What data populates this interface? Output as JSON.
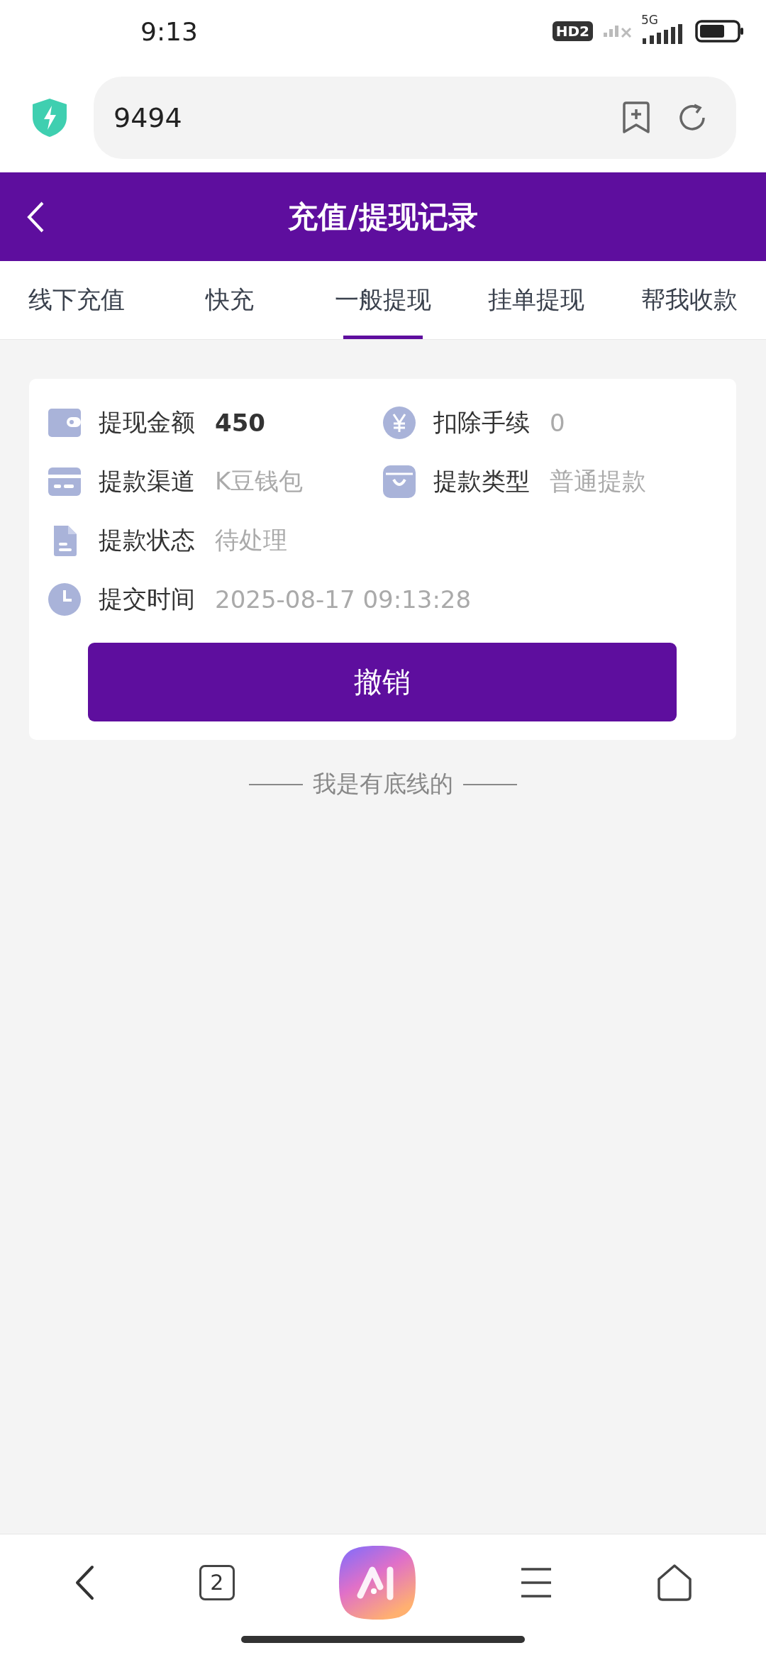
{
  "status_bar": {
    "time": "9:13",
    "hd_badge": "HD2",
    "network": "5G"
  },
  "address_bar": {
    "url": "9494"
  },
  "header": {
    "title": "充值/提现记录"
  },
  "tabs": [
    {
      "label": "线下充值",
      "selected": false
    },
    {
      "label": "快充",
      "selected": false
    },
    {
      "label": "一般提现",
      "selected": true
    },
    {
      "label": "挂单提现",
      "selected": false
    },
    {
      "label": "帮我收款",
      "selected": false
    }
  ],
  "record": {
    "rows": [
      [
        {
          "kind": "wallet",
          "label": "提现金额",
          "value": "450",
          "bold": true
        },
        {
          "kind": "yen",
          "label": "扣除手续",
          "value": "0",
          "bold": false
        }
      ],
      [
        {
          "kind": "card",
          "label": "提款渠道",
          "value": "K豆钱包",
          "bold": false
        },
        {
          "kind": "bag",
          "label": "提款类型",
          "value": "普通提款",
          "bold": false
        }
      ],
      [
        {
          "kind": "document",
          "label": "提款状态",
          "value": "待处理",
          "bold": false
        }
      ],
      [
        {
          "kind": "clock",
          "label": "提交时间",
          "value": "2025-08-17 09:13:28",
          "bold": false
        }
      ]
    ],
    "button": "撤销"
  },
  "end_note": "我是有底线的",
  "bottom_nav": {
    "tab_count": "2"
  }
}
